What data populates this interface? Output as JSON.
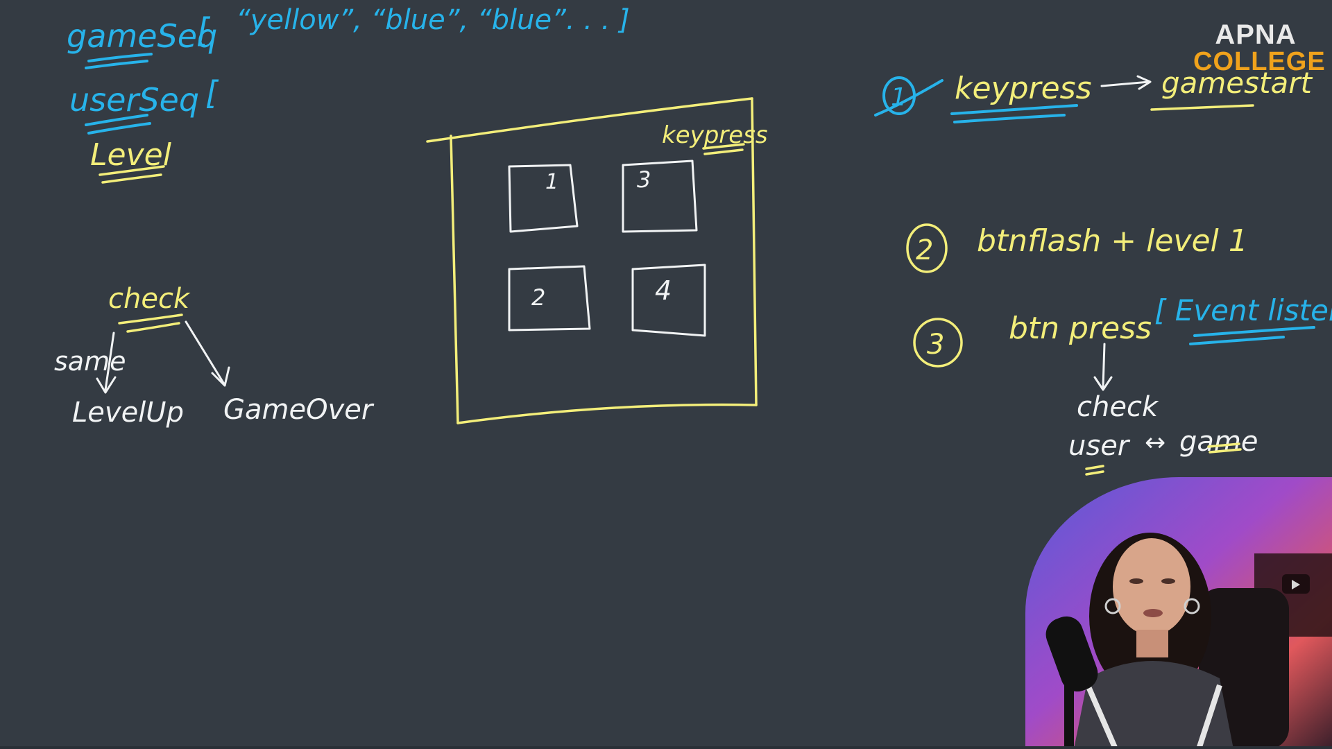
{
  "board": {
    "background": "#343b43",
    "colors": {
      "blue": "#27b3ea",
      "yellow": "#f3ee7a",
      "white": "#f1f3f4"
    },
    "variables": {
      "game_seq_label": "gameSeq",
      "game_seq_open": "[",
      "game_seq_items": "“yellow”, “blue”, “blue”. . . ]",
      "user_seq_label": "userSeq",
      "user_seq_open": "[",
      "level_label": "Level"
    },
    "flow": {
      "check": "check",
      "same": "same",
      "level_up": "LevelUp",
      "game_over": "GameOver"
    },
    "game_box": {
      "keypress": "keypress",
      "buttons": [
        "1",
        "3",
        "2",
        "4"
      ]
    },
    "steps": {
      "step1_number": "1",
      "step1_keypress": "keypress",
      "step1_result": "gamestart",
      "step2_number": "2",
      "step2_text": "btnflash + level 1",
      "step3_number": "3",
      "step3_text": "btn press",
      "step3_bracket": "[ Event listener",
      "step3_check": "check",
      "step3_user": "user",
      "step3_arrow": "↔",
      "step3_game": "game"
    }
  },
  "logo": {
    "line1": "APNA",
    "line2": "COLLEGE",
    "line1_color": "#e9e9e9",
    "line2_color": "#f0a21c"
  },
  "webcam": {
    "icon": "presenter-webcam"
  }
}
